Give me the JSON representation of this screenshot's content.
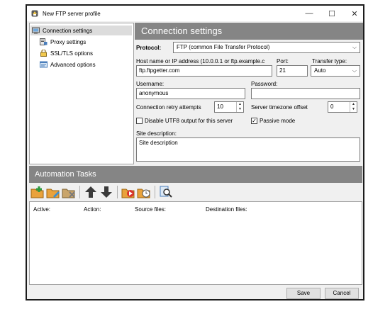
{
  "window": {
    "title": "New FTP server profile",
    "minimize": "—",
    "maximize": "☐",
    "close": "✕"
  },
  "sidebar": {
    "items": [
      {
        "label": "Connection settings",
        "icon": "connection-settings-icon"
      },
      {
        "label": "Proxy settings",
        "icon": "proxy-icon"
      },
      {
        "label": "SSL/TLS options",
        "icon": "lock-icon"
      },
      {
        "label": "Advanced options",
        "icon": "advanced-options-icon"
      }
    ]
  },
  "connection": {
    "header": "Connection settings",
    "protocol_label": "Protocol:",
    "protocol_value": "FTP (common File Transfer Protocol)",
    "host_label": "Host name or IP address (10.0.0.1 or ftp.example.c",
    "host_value": "ftp.ftpgetter.com",
    "port_label": "Port:",
    "port_value": "21",
    "transfer_label": "Transfer type:",
    "transfer_value": "Auto",
    "username_label": "Username:",
    "username_value": "anonymous",
    "password_label": "Password:",
    "password_value": "",
    "retry_label": "Connection retry attempts",
    "retry_value": "10",
    "timezone_label": "Server timezone offset",
    "timezone_value": "0",
    "utf8_label": "Disable UTF8 output for this server",
    "utf8_checked": false,
    "passive_label": "Passive mode",
    "passive_checked": true,
    "site_desc_label": "Site description:",
    "site_desc_value": "Site description"
  },
  "automation": {
    "header": "Automation Tasks",
    "toolbar": [
      "add-task-icon",
      "edit-task-icon",
      "delete-task-icon",
      "move-up-icon",
      "move-down-icon",
      "run-task-icon",
      "schedule-task-icon",
      "inspect-icon"
    ],
    "columns": [
      "Active:",
      "Action:",
      "Source files:",
      "Destination files:"
    ]
  },
  "buttons": {
    "save": "Save",
    "cancel": "Cancel"
  },
  "colors": {
    "header_bg": "#858585",
    "selected_bg": "#dcdcdc",
    "arrow_color": "#3a3a3a"
  }
}
